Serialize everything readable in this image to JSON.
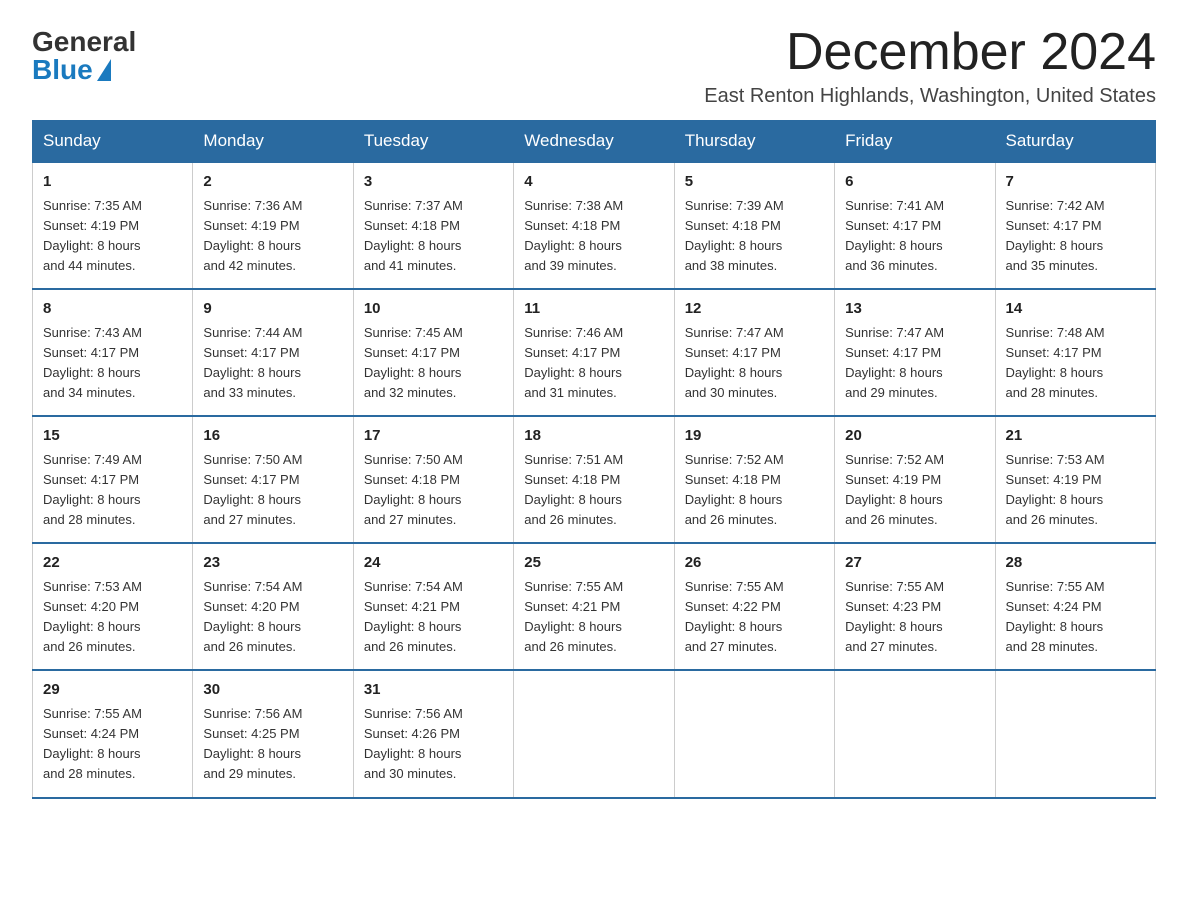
{
  "header": {
    "logo_general": "General",
    "logo_blue": "Blue",
    "month_title": "December 2024",
    "location": "East Renton Highlands, Washington, United States"
  },
  "days_of_week": [
    "Sunday",
    "Monday",
    "Tuesday",
    "Wednesday",
    "Thursday",
    "Friday",
    "Saturday"
  ],
  "weeks": [
    [
      {
        "day": "1",
        "sunrise": "7:35 AM",
        "sunset": "4:19 PM",
        "daylight": "8 hours and 44 minutes."
      },
      {
        "day": "2",
        "sunrise": "7:36 AM",
        "sunset": "4:19 PM",
        "daylight": "8 hours and 42 minutes."
      },
      {
        "day": "3",
        "sunrise": "7:37 AM",
        "sunset": "4:18 PM",
        "daylight": "8 hours and 41 minutes."
      },
      {
        "day": "4",
        "sunrise": "7:38 AM",
        "sunset": "4:18 PM",
        "daylight": "8 hours and 39 minutes."
      },
      {
        "day": "5",
        "sunrise": "7:39 AM",
        "sunset": "4:18 PM",
        "daylight": "8 hours and 38 minutes."
      },
      {
        "day": "6",
        "sunrise": "7:41 AM",
        "sunset": "4:17 PM",
        "daylight": "8 hours and 36 minutes."
      },
      {
        "day": "7",
        "sunrise": "7:42 AM",
        "sunset": "4:17 PM",
        "daylight": "8 hours and 35 minutes."
      }
    ],
    [
      {
        "day": "8",
        "sunrise": "7:43 AM",
        "sunset": "4:17 PM",
        "daylight": "8 hours and 34 minutes."
      },
      {
        "day": "9",
        "sunrise": "7:44 AM",
        "sunset": "4:17 PM",
        "daylight": "8 hours and 33 minutes."
      },
      {
        "day": "10",
        "sunrise": "7:45 AM",
        "sunset": "4:17 PM",
        "daylight": "8 hours and 32 minutes."
      },
      {
        "day": "11",
        "sunrise": "7:46 AM",
        "sunset": "4:17 PM",
        "daylight": "8 hours and 31 minutes."
      },
      {
        "day": "12",
        "sunrise": "7:47 AM",
        "sunset": "4:17 PM",
        "daylight": "8 hours and 30 minutes."
      },
      {
        "day": "13",
        "sunrise": "7:47 AM",
        "sunset": "4:17 PM",
        "daylight": "8 hours and 29 minutes."
      },
      {
        "day": "14",
        "sunrise": "7:48 AM",
        "sunset": "4:17 PM",
        "daylight": "8 hours and 28 minutes."
      }
    ],
    [
      {
        "day": "15",
        "sunrise": "7:49 AM",
        "sunset": "4:17 PM",
        "daylight": "8 hours and 28 minutes."
      },
      {
        "day": "16",
        "sunrise": "7:50 AM",
        "sunset": "4:17 PM",
        "daylight": "8 hours and 27 minutes."
      },
      {
        "day": "17",
        "sunrise": "7:50 AM",
        "sunset": "4:18 PM",
        "daylight": "8 hours and 27 minutes."
      },
      {
        "day": "18",
        "sunrise": "7:51 AM",
        "sunset": "4:18 PM",
        "daylight": "8 hours and 26 minutes."
      },
      {
        "day": "19",
        "sunrise": "7:52 AM",
        "sunset": "4:18 PM",
        "daylight": "8 hours and 26 minutes."
      },
      {
        "day": "20",
        "sunrise": "7:52 AM",
        "sunset": "4:19 PM",
        "daylight": "8 hours and 26 minutes."
      },
      {
        "day": "21",
        "sunrise": "7:53 AM",
        "sunset": "4:19 PM",
        "daylight": "8 hours and 26 minutes."
      }
    ],
    [
      {
        "day": "22",
        "sunrise": "7:53 AM",
        "sunset": "4:20 PM",
        "daylight": "8 hours and 26 minutes."
      },
      {
        "day": "23",
        "sunrise": "7:54 AM",
        "sunset": "4:20 PM",
        "daylight": "8 hours and 26 minutes."
      },
      {
        "day": "24",
        "sunrise": "7:54 AM",
        "sunset": "4:21 PM",
        "daylight": "8 hours and 26 minutes."
      },
      {
        "day": "25",
        "sunrise": "7:55 AM",
        "sunset": "4:21 PM",
        "daylight": "8 hours and 26 minutes."
      },
      {
        "day": "26",
        "sunrise": "7:55 AM",
        "sunset": "4:22 PM",
        "daylight": "8 hours and 27 minutes."
      },
      {
        "day": "27",
        "sunrise": "7:55 AM",
        "sunset": "4:23 PM",
        "daylight": "8 hours and 27 minutes."
      },
      {
        "day": "28",
        "sunrise": "7:55 AM",
        "sunset": "4:24 PM",
        "daylight": "8 hours and 28 minutes."
      }
    ],
    [
      {
        "day": "29",
        "sunrise": "7:55 AM",
        "sunset": "4:24 PM",
        "daylight": "8 hours and 28 minutes."
      },
      {
        "day": "30",
        "sunrise": "7:56 AM",
        "sunset": "4:25 PM",
        "daylight": "8 hours and 29 minutes."
      },
      {
        "day": "31",
        "sunrise": "7:56 AM",
        "sunset": "4:26 PM",
        "daylight": "8 hours and 30 minutes."
      },
      null,
      null,
      null,
      null
    ]
  ],
  "labels": {
    "sunrise": "Sunrise:",
    "sunset": "Sunset:",
    "daylight": "Daylight:"
  }
}
